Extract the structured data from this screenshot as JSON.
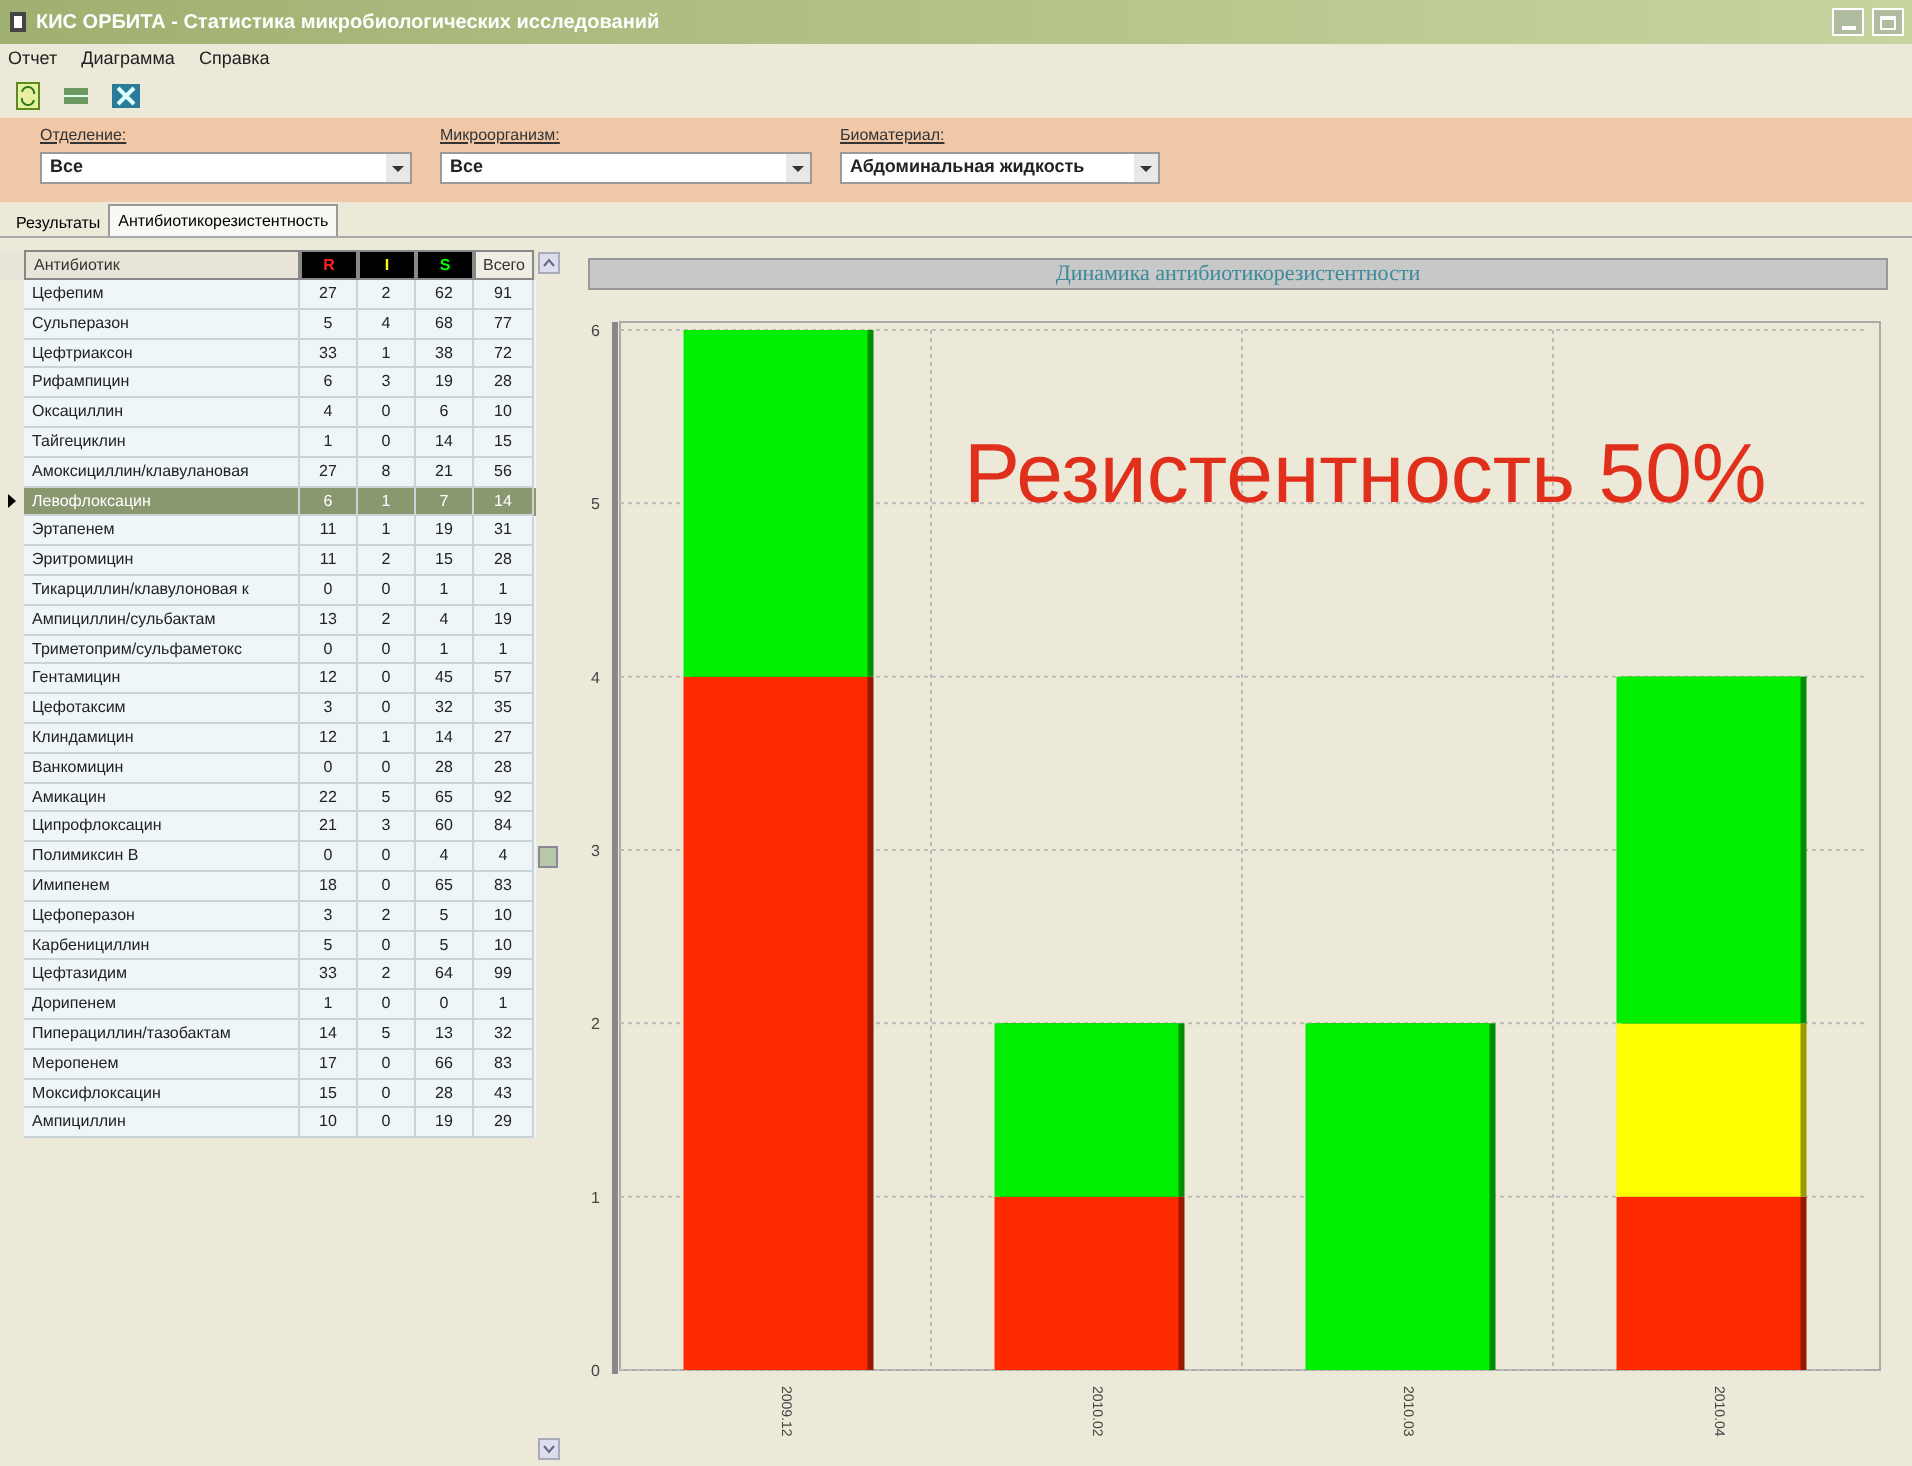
{
  "window": {
    "title": "КИС ОРБИТА - Статистика микробиологических исследований"
  },
  "menu": [
    "Отчет",
    "Диаграмма",
    "Справка"
  ],
  "filters": [
    {
      "label": "Отделение:",
      "value": "Все"
    },
    {
      "label": "Микроорганизм:",
      "value": "Все"
    },
    {
      "label": "Биоматериал:",
      "value": "Абдоминальная жидкость"
    }
  ],
  "tabs": [
    {
      "label": "Результаты",
      "selected": false
    },
    {
      "label": "Антибиотикорезистентность",
      "selected": true
    }
  ],
  "table": {
    "columns": [
      "Антибиотик",
      "R",
      "I",
      "S",
      "Всего"
    ],
    "rows": [
      {
        "cells": [
          "Цефепим",
          "27",
          "2",
          "62",
          "91"
        ],
        "selected": false
      },
      {
        "cells": [
          "Сульперазон",
          "5",
          "4",
          "68",
          "77"
        ],
        "selected": false
      },
      {
        "cells": [
          "Цефтриаксон",
          "33",
          "1",
          "38",
          "72"
        ],
        "selected": false
      },
      {
        "cells": [
          "Рифампицин",
          "6",
          "3",
          "19",
          "28"
        ],
        "selected": false
      },
      {
        "cells": [
          "Оксациллин",
          "4",
          "0",
          "6",
          "10"
        ],
        "selected": false
      },
      {
        "cells": [
          "Тайгециклин",
          "1",
          "0",
          "14",
          "15"
        ],
        "selected": false
      },
      {
        "cells": [
          "Амоксициллин/клавулановая",
          "27",
          "8",
          "21",
          "56"
        ],
        "selected": false
      },
      {
        "cells": [
          "Левофлоксацин",
          "6",
          "1",
          "7",
          "14"
        ],
        "selected": true
      },
      {
        "cells": [
          "Эртапенем",
          "11",
          "1",
          "19",
          "31"
        ],
        "selected": false
      },
      {
        "cells": [
          "Эритромицин",
          "11",
          "2",
          "15",
          "28"
        ],
        "selected": false
      },
      {
        "cells": [
          "Тикарциллин/клавулоновая к",
          "0",
          "0",
          "1",
          "1"
        ],
        "selected": false
      },
      {
        "cells": [
          "Ампициллин/сульбактам",
          "13",
          "2",
          "4",
          "19"
        ],
        "selected": false
      },
      {
        "cells": [
          "Триметоприм/сульфаметокс",
          "0",
          "0",
          "1",
          "1"
        ],
        "selected": false
      },
      {
        "cells": [
          "Гентамицин",
          "12",
          "0",
          "45",
          "57"
        ],
        "selected": false
      },
      {
        "cells": [
          "Цефотаксим",
          "3",
          "0",
          "32",
          "35"
        ],
        "selected": false
      },
      {
        "cells": [
          "Клиндамицин",
          "12",
          "1",
          "14",
          "27"
        ],
        "selected": false
      },
      {
        "cells": [
          "Ванкомицин",
          "0",
          "0",
          "28",
          "28"
        ],
        "selected": false
      },
      {
        "cells": [
          "Амикацин",
          "22",
          "5",
          "65",
          "92"
        ],
        "selected": false
      },
      {
        "cells": [
          "Ципрофлоксацин",
          "21",
          "3",
          "60",
          "84"
        ],
        "selected": false
      },
      {
        "cells": [
          "Полимиксин В",
          "0",
          "0",
          "4",
          "4"
        ],
        "selected": false
      },
      {
        "cells": [
          "Имипенем",
          "18",
          "0",
          "65",
          "83"
        ],
        "selected": false
      },
      {
        "cells": [
          "Цефоперазон",
          "3",
          "2",
          "5",
          "10"
        ],
        "selected": false
      },
      {
        "cells": [
          "Карбенициллин",
          "5",
          "0",
          "5",
          "10"
        ],
        "selected": false
      },
      {
        "cells": [
          "Цефтазидим",
          "33",
          "2",
          "64",
          "99"
        ],
        "selected": false
      },
      {
        "cells": [
          "Дорипенем",
          "1",
          "0",
          "0",
          "1"
        ],
        "selected": false
      },
      {
        "cells": [
          "Пиперациллин/тазобактам",
          "14",
          "5",
          "13",
          "32"
        ],
        "selected": false
      },
      {
        "cells": [
          "Меропенем",
          "17",
          "0",
          "66",
          "83"
        ],
        "selected": false
      },
      {
        "cells": [
          "Моксифлоксацин",
          "15",
          "0",
          "28",
          "43"
        ],
        "selected": false
      },
      {
        "cells": [
          "Ампициллин",
          "10",
          "0",
          "19",
          "29"
        ],
        "selected": false
      }
    ]
  },
  "chart": {
    "overlay_text": "Резистентность 50%",
    "chart_data": {
      "type": "bar",
      "stacked": true,
      "title": "Динамика антибиотикорезистентности",
      "categories": [
        "2009.12",
        "2010.02",
        "2010.03",
        "2010.04"
      ],
      "series": [
        {
          "color": "#ff2a00",
          "values": [
            4,
            1,
            0,
            1
          ]
        },
        {
          "color": "#ffff00",
          "values": [
            0,
            0,
            0,
            1
          ]
        },
        {
          "color": "#00ee00",
          "values": [
            2,
            1,
            2,
            2
          ]
        }
      ],
      "grid": true,
      "ylim": [
        0,
        6
      ],
      "yticks": [
        0,
        1,
        2,
        3,
        4,
        5,
        6
      ]
    }
  }
}
